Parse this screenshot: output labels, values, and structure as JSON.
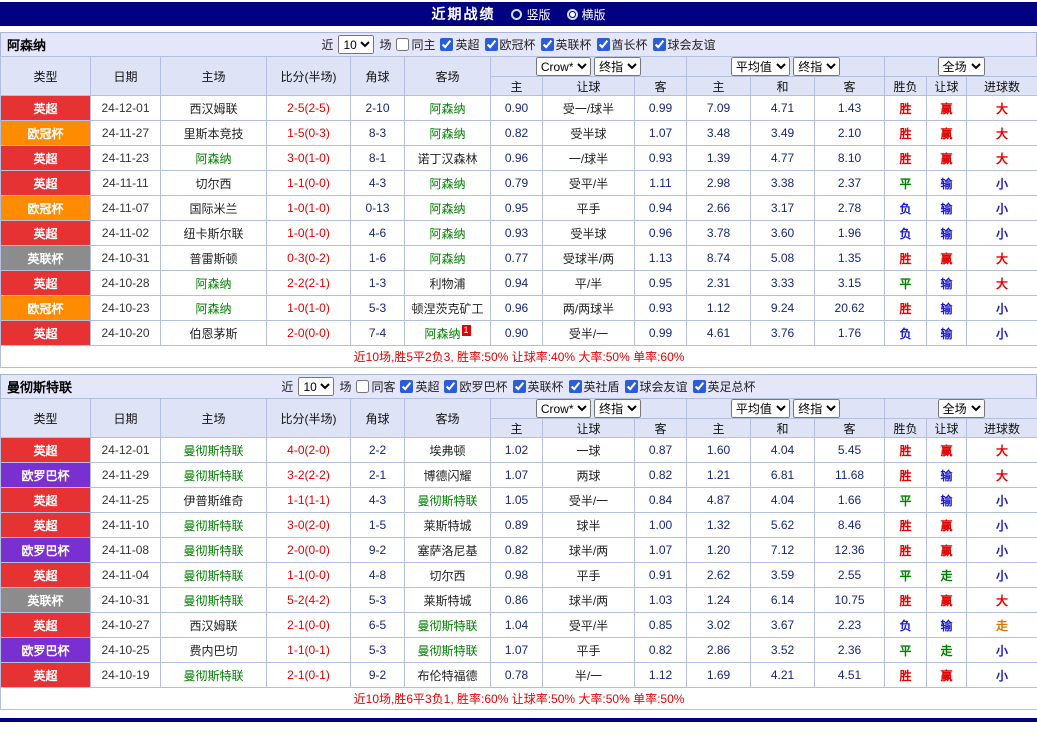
{
  "topbar": {
    "title": "近期战绩",
    "radio_vertical": "竖版",
    "radio_horizontal": "横版",
    "selected": "横版"
  },
  "colors": {
    "topbar_bg": "#000080",
    "table_header_bg": "#dfe3f6",
    "section_header_bg": "#e4e6fa",
    "border": "#b4bede",
    "league": {
      "英超": "#e63232",
      "欧冠杯": "#ff8c00",
      "英联杯": "#8c8c8c",
      "欧罗巴杯": "#7a2fd0"
    },
    "result": {
      "r": "#e60000",
      "g": "#008000",
      "b": "#1a1acd",
      "o": "#d87800"
    },
    "focus_team": "#008000",
    "score": "#e60000",
    "odds": "#16257a",
    "summary": "#e60000"
  },
  "sections": [
    {
      "team": "阿森纳",
      "filter": {
        "near_label": "近",
        "count": "10",
        "games_label": "场",
        "same_label": "同主",
        "same_checked": false,
        "leagues": [
          "英超",
          "欧冠杯",
          "英联杯",
          "酋长杯",
          "球会友谊"
        ]
      },
      "header": {
        "col_type": "类型",
        "col_date": "日期",
        "col_home": "主场",
        "col_score": "比分(半场)",
        "col_corner": "角球",
        "col_away": "客场",
        "odds_select1": "Crow*",
        "odds_select2": "终指",
        "avg_select1": "平均值",
        "avg_select2": "终指",
        "scope_select": "全场",
        "sub": [
          "主",
          "让球",
          "客",
          "主",
          "和",
          "客",
          "胜负",
          "让球",
          "进球数"
        ]
      },
      "rows": [
        {
          "type": "英超",
          "date": "24-12-01",
          "home": "西汉姆联",
          "home_focus": false,
          "score": "2-5(2-5)",
          "corner": "2-10",
          "away": "阿森纳",
          "away_focus": true,
          "badge": "",
          "odds": [
            "0.90",
            "受一/球半",
            "0.99"
          ],
          "avg": [
            "7.09",
            "4.71",
            "1.43"
          ],
          "results": [
            {
              "t": "胜",
              "c": "r"
            },
            {
              "t": "赢",
              "c": "r"
            },
            {
              "t": "大",
              "c": "r"
            }
          ]
        },
        {
          "type": "欧冠杯",
          "date": "24-11-27",
          "home": "里斯本竞技",
          "home_focus": false,
          "score": "1-5(0-3)",
          "corner": "8-3",
          "away": "阿森纳",
          "away_focus": true,
          "badge": "",
          "odds": [
            "0.82",
            "受半球",
            "1.07"
          ],
          "avg": [
            "3.48",
            "3.49",
            "2.10"
          ],
          "results": [
            {
              "t": "胜",
              "c": "r"
            },
            {
              "t": "赢",
              "c": "r"
            },
            {
              "t": "大",
              "c": "r"
            }
          ]
        },
        {
          "type": "英超",
          "date": "24-11-23",
          "home": "阿森纳",
          "home_focus": true,
          "score": "3-0(1-0)",
          "corner": "8-1",
          "away": "诺丁汉森林",
          "away_focus": false,
          "badge": "",
          "odds": [
            "0.96",
            "一/球半",
            "0.93"
          ],
          "avg": [
            "1.39",
            "4.77",
            "8.10"
          ],
          "results": [
            {
              "t": "胜",
              "c": "r"
            },
            {
              "t": "赢",
              "c": "r"
            },
            {
              "t": "大",
              "c": "r"
            }
          ]
        },
        {
          "type": "英超",
          "date": "24-11-11",
          "home": "切尔西",
          "home_focus": false,
          "score": "1-1(0-0)",
          "corner": "4-3",
          "away": "阿森纳",
          "away_focus": true,
          "badge": "",
          "odds": [
            "0.79",
            "受平/半",
            "1.11"
          ],
          "avg": [
            "2.98",
            "3.38",
            "2.37"
          ],
          "results": [
            {
              "t": "平",
              "c": "g"
            },
            {
              "t": "输",
              "c": "b"
            },
            {
              "t": "小",
              "c": "b"
            }
          ]
        },
        {
          "type": "欧冠杯",
          "date": "24-11-07",
          "home": "国际米兰",
          "home_focus": false,
          "score": "1-0(1-0)",
          "corner": "0-13",
          "away": "阿森纳",
          "away_focus": true,
          "badge": "",
          "odds": [
            "0.95",
            "平手",
            "0.94"
          ],
          "avg": [
            "2.66",
            "3.17",
            "2.78"
          ],
          "results": [
            {
              "t": "负",
              "c": "b"
            },
            {
              "t": "输",
              "c": "b"
            },
            {
              "t": "小",
              "c": "b"
            }
          ]
        },
        {
          "type": "英超",
          "date": "24-11-02",
          "home": "纽卡斯尔联",
          "home_focus": false,
          "score": "1-0(1-0)",
          "corner": "4-6",
          "away": "阿森纳",
          "away_focus": true,
          "badge": "",
          "odds": [
            "0.93",
            "受半球",
            "0.96"
          ],
          "avg": [
            "3.78",
            "3.60",
            "1.96"
          ],
          "results": [
            {
              "t": "负",
              "c": "b"
            },
            {
              "t": "输",
              "c": "b"
            },
            {
              "t": "小",
              "c": "b"
            }
          ]
        },
        {
          "type": "英联杯",
          "date": "24-10-31",
          "home": "普雷斯顿",
          "home_focus": false,
          "score": "0-3(0-2)",
          "corner": "1-6",
          "away": "阿森纳",
          "away_focus": true,
          "badge": "",
          "odds": [
            "0.77",
            "受球半/两",
            "1.13"
          ],
          "avg": [
            "8.74",
            "5.08",
            "1.35"
          ],
          "results": [
            {
              "t": "胜",
              "c": "r"
            },
            {
              "t": "赢",
              "c": "r"
            },
            {
              "t": "大",
              "c": "r"
            }
          ]
        },
        {
          "type": "英超",
          "date": "24-10-28",
          "home": "阿森纳",
          "home_focus": true,
          "score": "2-2(2-1)",
          "corner": "1-3",
          "away": "利物浦",
          "away_focus": false,
          "badge": "",
          "odds": [
            "0.94",
            "平/半",
            "0.95"
          ],
          "avg": [
            "2.31",
            "3.33",
            "3.15"
          ],
          "results": [
            {
              "t": "平",
              "c": "g"
            },
            {
              "t": "输",
              "c": "b"
            },
            {
              "t": "大",
              "c": "r"
            }
          ]
        },
        {
          "type": "欧冠杯",
          "date": "24-10-23",
          "home": "阿森纳",
          "home_focus": true,
          "score": "1-0(1-0)",
          "corner": "5-3",
          "away": "顿涅茨克矿工",
          "away_focus": false,
          "badge": "",
          "odds": [
            "0.96",
            "两/两球半",
            "0.93"
          ],
          "avg": [
            "1.12",
            "9.24",
            "20.62"
          ],
          "results": [
            {
              "t": "胜",
              "c": "r"
            },
            {
              "t": "输",
              "c": "b"
            },
            {
              "t": "小",
              "c": "b"
            }
          ]
        },
        {
          "type": "英超",
          "date": "24-10-20",
          "home": "伯恩茅斯",
          "home_focus": false,
          "score": "2-0(0-0)",
          "corner": "7-4",
          "away": "阿森纳",
          "away_focus": true,
          "badge": "1",
          "odds": [
            "0.90",
            "受半/一",
            "0.99"
          ],
          "avg": [
            "4.61",
            "3.76",
            "1.76"
          ],
          "results": [
            {
              "t": "负",
              "c": "b"
            },
            {
              "t": "输",
              "c": "b"
            },
            {
              "t": "小",
              "c": "b"
            }
          ]
        }
      ],
      "footer": "近10场,胜5平2负3, 胜率:50% 让球率:40% 大率:50% 单率:60%"
    },
    {
      "team": "曼彻斯特联",
      "filter": {
        "near_label": "近",
        "count": "10",
        "games_label": "场",
        "same_label": "同客",
        "same_checked": false,
        "leagues": [
          "英超",
          "欧罗巴杯",
          "英联杯",
          "英社盾",
          "球会友谊",
          "英足总杯"
        ]
      },
      "header": {
        "col_type": "类型",
        "col_date": "日期",
        "col_home": "主场",
        "col_score": "比分(半场)",
        "col_corner": "角球",
        "col_away": "客场",
        "odds_select1": "Crow*",
        "odds_select2": "终指",
        "avg_select1": "平均值",
        "avg_select2": "终指",
        "scope_select": "全场",
        "sub": [
          "主",
          "让球",
          "客",
          "主",
          "和",
          "客",
          "胜负",
          "让球",
          "进球数"
        ]
      },
      "rows": [
        {
          "type": "英超",
          "date": "24-12-01",
          "home": "曼彻斯特联",
          "home_focus": true,
          "score": "4-0(2-0)",
          "corner": "2-2",
          "away": "埃弗顿",
          "away_focus": false,
          "badge": "",
          "odds": [
            "1.02",
            "一球",
            "0.87"
          ],
          "avg": [
            "1.60",
            "4.04",
            "5.45"
          ],
          "results": [
            {
              "t": "胜",
              "c": "r"
            },
            {
              "t": "赢",
              "c": "r"
            },
            {
              "t": "大",
              "c": "r"
            }
          ]
        },
        {
          "type": "欧罗巴杯",
          "date": "24-11-29",
          "home": "曼彻斯特联",
          "home_focus": true,
          "score": "3-2(2-2)",
          "corner": "2-1",
          "away": "博德闪耀",
          "away_focus": false,
          "badge": "",
          "odds": [
            "1.07",
            "两球",
            "0.82"
          ],
          "avg": [
            "1.21",
            "6.81",
            "11.68"
          ],
          "results": [
            {
              "t": "胜",
              "c": "r"
            },
            {
              "t": "输",
              "c": "b"
            },
            {
              "t": "大",
              "c": "r"
            }
          ]
        },
        {
          "type": "英超",
          "date": "24-11-25",
          "home": "伊普斯维奇",
          "home_focus": false,
          "score": "1-1(1-1)",
          "corner": "4-3",
          "away": "曼彻斯特联",
          "away_focus": true,
          "badge": "",
          "odds": [
            "1.05",
            "受半/一",
            "0.84"
          ],
          "avg": [
            "4.87",
            "4.04",
            "1.66"
          ],
          "results": [
            {
              "t": "平",
              "c": "g"
            },
            {
              "t": "输",
              "c": "b"
            },
            {
              "t": "小",
              "c": "b"
            }
          ]
        },
        {
          "type": "英超",
          "date": "24-11-10",
          "home": "曼彻斯特联",
          "home_focus": true,
          "score": "3-0(2-0)",
          "corner": "1-5",
          "away": "莱斯特城",
          "away_focus": false,
          "badge": "",
          "odds": [
            "0.89",
            "球半",
            "1.00"
          ],
          "avg": [
            "1.32",
            "5.62",
            "8.46"
          ],
          "results": [
            {
              "t": "胜",
              "c": "r"
            },
            {
              "t": "赢",
              "c": "r"
            },
            {
              "t": "小",
              "c": "b"
            }
          ]
        },
        {
          "type": "欧罗巴杯",
          "date": "24-11-08",
          "home": "曼彻斯特联",
          "home_focus": true,
          "score": "2-0(0-0)",
          "corner": "9-2",
          "away": "塞萨洛尼基",
          "away_focus": false,
          "badge": "",
          "odds": [
            "0.82",
            "球半/两",
            "1.07"
          ],
          "avg": [
            "1.20",
            "7.12",
            "12.36"
          ],
          "results": [
            {
              "t": "胜",
              "c": "r"
            },
            {
              "t": "赢",
              "c": "r"
            },
            {
              "t": "小",
              "c": "b"
            }
          ]
        },
        {
          "type": "英超",
          "date": "24-11-04",
          "home": "曼彻斯特联",
          "home_focus": true,
          "score": "1-1(0-0)",
          "corner": "4-8",
          "away": "切尔西",
          "away_focus": false,
          "badge": "",
          "odds": [
            "0.98",
            "平手",
            "0.91"
          ],
          "avg": [
            "2.62",
            "3.59",
            "2.55"
          ],
          "results": [
            {
              "t": "平",
              "c": "g"
            },
            {
              "t": "走",
              "c": "g"
            },
            {
              "t": "小",
              "c": "b"
            }
          ]
        },
        {
          "type": "英联杯",
          "date": "24-10-31",
          "home": "曼彻斯特联",
          "home_focus": true,
          "score": "5-2(4-2)",
          "corner": "5-3",
          "away": "莱斯特城",
          "away_focus": false,
          "badge": "",
          "odds": [
            "0.86",
            "球半/两",
            "1.03"
          ],
          "avg": [
            "1.24",
            "6.14",
            "10.75"
          ],
          "results": [
            {
              "t": "胜",
              "c": "r"
            },
            {
              "t": "赢",
              "c": "r"
            },
            {
              "t": "大",
              "c": "r"
            }
          ]
        },
        {
          "type": "英超",
          "date": "24-10-27",
          "home": "西汉姆联",
          "home_focus": false,
          "score": "2-1(0-0)",
          "corner": "6-5",
          "away": "曼彻斯特联",
          "away_focus": true,
          "badge": "",
          "odds": [
            "1.04",
            "受平/半",
            "0.85"
          ],
          "avg": [
            "3.02",
            "3.67",
            "2.23"
          ],
          "results": [
            {
              "t": "负",
              "c": "b"
            },
            {
              "t": "输",
              "c": "b"
            },
            {
              "t": "走",
              "c": "o"
            }
          ]
        },
        {
          "type": "欧罗巴杯",
          "date": "24-10-25",
          "home": "费内巴切",
          "home_focus": false,
          "score": "1-1(0-1)",
          "corner": "5-3",
          "away": "曼彻斯特联",
          "away_focus": true,
          "badge": "",
          "odds": [
            "1.07",
            "平手",
            "0.82"
          ],
          "avg": [
            "2.86",
            "3.52",
            "2.36"
          ],
          "results": [
            {
              "t": "平",
              "c": "g"
            },
            {
              "t": "走",
              "c": "g"
            },
            {
              "t": "小",
              "c": "b"
            }
          ]
        },
        {
          "type": "英超",
          "date": "24-10-19",
          "home": "曼彻斯特联",
          "home_focus": true,
          "score": "2-1(0-1)",
          "corner": "9-2",
          "away": "布伦特福德",
          "away_focus": false,
          "badge": "",
          "odds": [
            "0.78",
            "半/一",
            "1.12"
          ],
          "avg": [
            "1.69",
            "4.21",
            "4.51"
          ],
          "results": [
            {
              "t": "胜",
              "c": "r"
            },
            {
              "t": "赢",
              "c": "r"
            },
            {
              "t": "小",
              "c": "b"
            }
          ]
        }
      ],
      "footer": "近10场,胜6平3负1, 胜率:60% 让球率:50% 大率:50% 单率:50%"
    }
  ]
}
